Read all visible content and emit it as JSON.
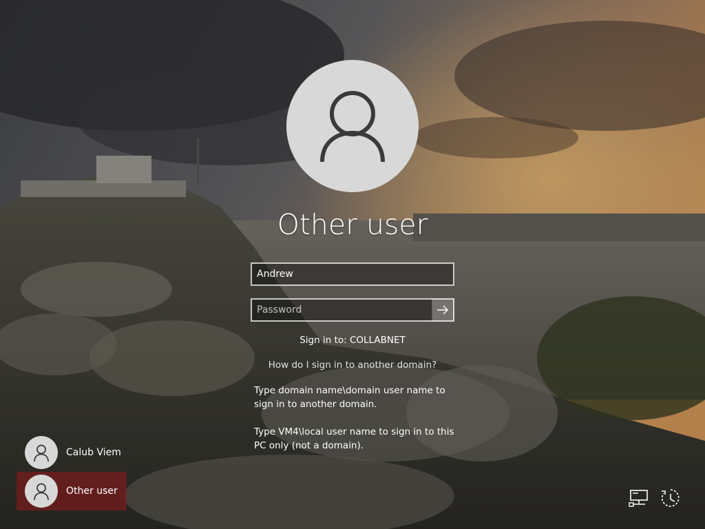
{
  "screen": {
    "title": "Other user",
    "username_value": "Andrew",
    "password_placeholder": "Password",
    "sign_in_to": "Sign in to: COLLABNET",
    "help_link": "How do I sign in to another domain?",
    "help_para_1": "Type domain name\\domain user name to sign in to another domain.",
    "help_para_2": "Type VM4\\local user name to sign in to this PC only (not a domain)."
  },
  "users": [
    {
      "name": "Calub Viem",
      "selected": false
    },
    {
      "name": "Other user",
      "selected": true
    }
  ],
  "system_icons": [
    "network-icon",
    "ease-of-access-icon"
  ],
  "colors": {
    "selected_user_bg": "#7a1c1c",
    "avatar_bg": "#d8d8d8",
    "avatar_glyph": "#3a3a3a"
  }
}
